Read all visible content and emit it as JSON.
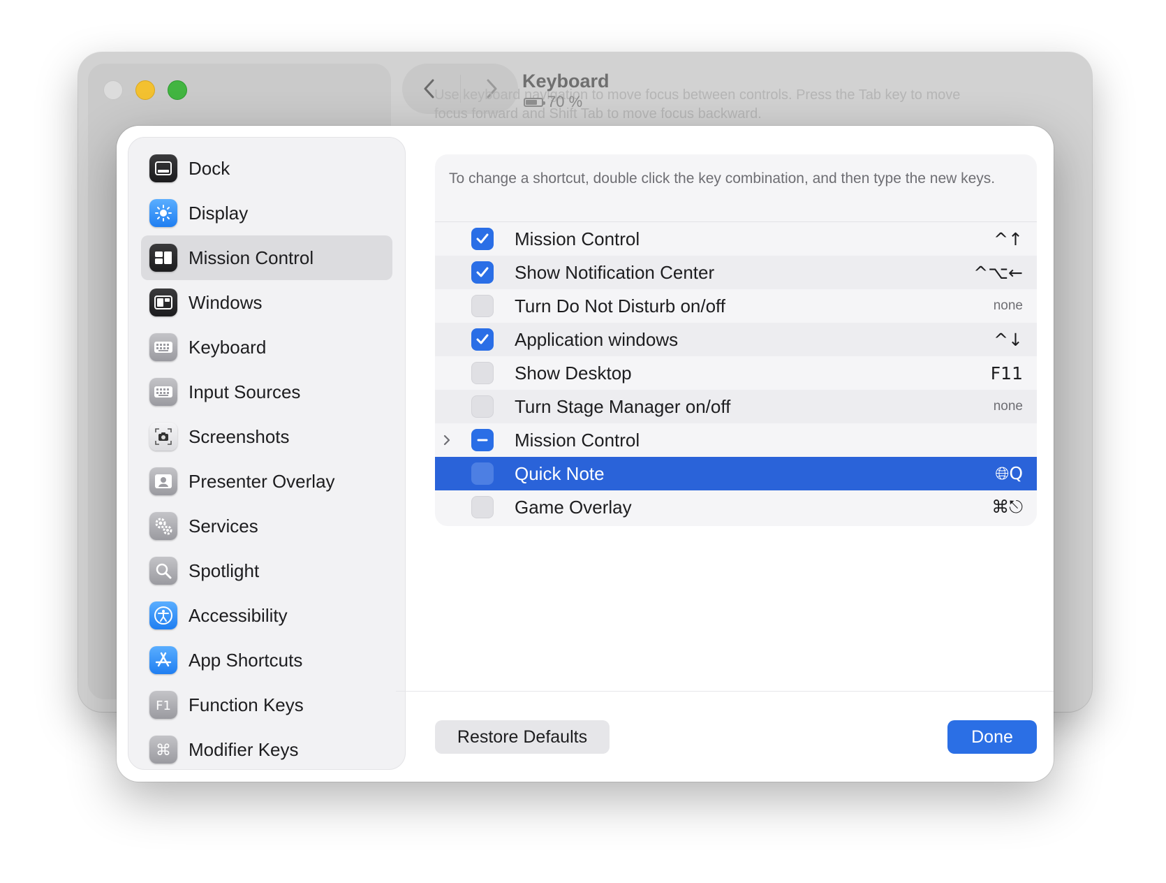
{
  "background_window": {
    "title": "Keyboard",
    "battery": "70 %",
    "hint_text": "Use keyboard navigation to move focus between controls. Press the Tab key to move focus forward and Shift Tab to move focus backward."
  },
  "sidebar": {
    "items": [
      {
        "label": "Dock",
        "icon": "dock-icon"
      },
      {
        "label": "Display",
        "icon": "display-brightness-icon"
      },
      {
        "label": "Mission Control",
        "icon": "mission-control-icon",
        "selected": true
      },
      {
        "label": "Windows",
        "icon": "windows-icon"
      },
      {
        "label": "Keyboard",
        "icon": "keyboard-icon"
      },
      {
        "label": "Input Sources",
        "icon": "input-sources-keyboard-icon"
      },
      {
        "label": "Screenshots",
        "icon": "camera-icon"
      },
      {
        "label": "Presenter Overlay",
        "icon": "presenter-overlay-icon"
      },
      {
        "label": "Services",
        "icon": "gears-icon"
      },
      {
        "label": "Spotlight",
        "icon": "magnifier-icon"
      },
      {
        "label": "Accessibility",
        "icon": "accessibility-icon"
      },
      {
        "label": "App Shortcuts",
        "icon": "app-store-icon"
      },
      {
        "label": "Function Keys",
        "icon": "f1-key-icon"
      },
      {
        "label": "Modifier Keys",
        "icon": "command-key-icon"
      }
    ]
  },
  "panel": {
    "description": "To change a shortcut, double click the key combination, and then type the new keys.",
    "rows": [
      {
        "label": "Mission Control",
        "state": "on",
        "shortcut": "^↑"
      },
      {
        "label": "Show Notification Center",
        "state": "on",
        "shortcut": "^⌥←"
      },
      {
        "label": "Turn Do Not Disturb on/off",
        "state": "off",
        "shortcut": "none"
      },
      {
        "label": "Application windows",
        "state": "on",
        "shortcut": "^↓"
      },
      {
        "label": "Show Desktop",
        "state": "off",
        "shortcut": "F11"
      },
      {
        "label": "Turn Stage Manager on/off",
        "state": "off",
        "shortcut": "none"
      },
      {
        "label": "Mission Control",
        "state": "mixed",
        "shortcut": ""
      },
      {
        "label": "Quick Note",
        "state": "off",
        "shortcut": "🌐︎Q",
        "selected": true
      },
      {
        "label": "Game Overlay",
        "state": "off",
        "shortcut": "⌘⎋"
      }
    ]
  },
  "buttons": {
    "restore_defaults": "Restore Defaults",
    "done": "Done"
  },
  "colors": {
    "accent": "#2a6ee6",
    "selection": "#2a63d9",
    "sidebar_bg": "#f2f2f4"
  }
}
